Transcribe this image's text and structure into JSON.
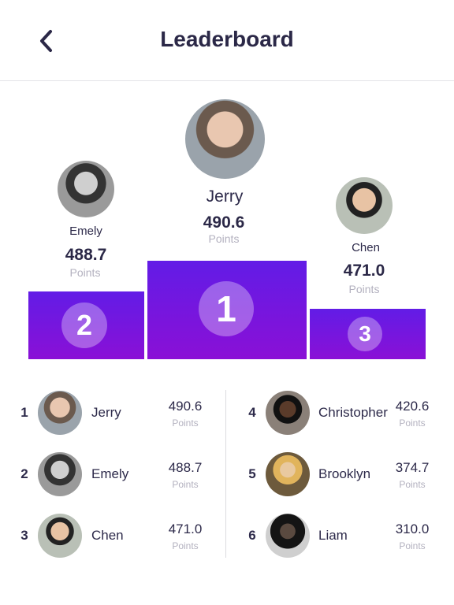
{
  "header": {
    "title": "Leaderboard",
    "back_icon": "chevron-left-icon"
  },
  "colors": {
    "podium_top": "#621ce6",
    "podium_bottom": "#8a10d6",
    "text": "#2d2a4a",
    "muted": "#b3b1bf"
  },
  "podium": [
    {
      "place": "1",
      "name": "Jerry",
      "score": "490.6",
      "unit": "Points"
    },
    {
      "place": "2",
      "name": "Emely",
      "score": "488.7",
      "unit": "Points"
    },
    {
      "place": "3",
      "name": "Chen",
      "score": "471.0",
      "unit": "Points"
    }
  ],
  "list": [
    {
      "rank": "1",
      "name": "Jerry",
      "score": "490.6",
      "unit": "Points"
    },
    {
      "rank": "2",
      "name": "Emely",
      "score": "488.7",
      "unit": "Points"
    },
    {
      "rank": "3",
      "name": "Chen",
      "score": "471.0",
      "unit": "Points"
    },
    {
      "rank": "4",
      "name": "Christopher",
      "score": "420.6",
      "unit": "Points"
    },
    {
      "rank": "5",
      "name": "Brooklyn",
      "score": "374.7",
      "unit": "Points"
    },
    {
      "rank": "6",
      "name": "Liam",
      "score": "310.0",
      "unit": "Points"
    }
  ]
}
